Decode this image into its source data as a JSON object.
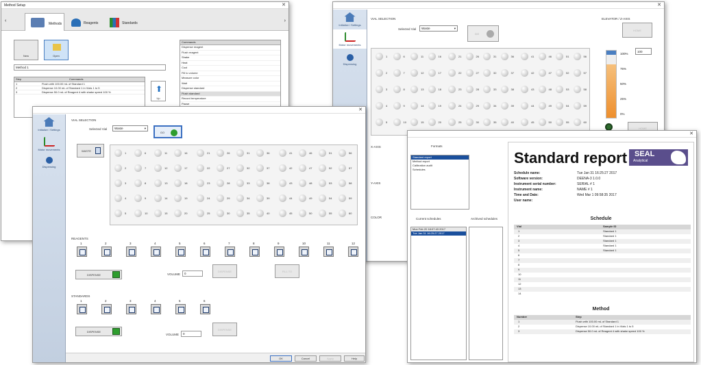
{
  "method_setup": {
    "title": "Method Setup",
    "tabs": [
      "Methods",
      "Reagents",
      "Standards"
    ],
    "new_label": "New",
    "open_label": "Open",
    "method_name": "Method 1",
    "steps_header": [
      "Step",
      "Commands"
    ],
    "steps": [
      [
        "1",
        "Flush with 100.00 mL of Standard 1"
      ],
      [
        "2",
        "Dispense 10.00 mL of Standard 1 in Vials 1 to 5"
      ],
      [
        "3",
        "Dispense 50.0 mL of Reagent 4 with shake speed 100 %"
      ]
    ],
    "up_label": "Up",
    "commands_header": "Commands",
    "commands": [
      "Dispense reagent",
      "Flush reagent",
      "Shake",
      "Heat",
      "Cool",
      "Fill to volume",
      "Measure color",
      "Wait",
      "Dispense standard",
      "Flush standard",
      "Record temperature",
      "Pause"
    ]
  },
  "motor_window": {
    "sidebar": [
      "Initialize / Settings",
      "Motor movements",
      "Dispensing"
    ],
    "vial_selection": "VIAL SELECTION",
    "selected_vial_label": "Selected Vial",
    "selected_vial": "Waste",
    "go_label": "GO",
    "elevator_label": "ELEVATOR / Z-AXIS",
    "home_label": "HOME",
    "levels": [
      "100%",
      "75%",
      "50%",
      "25%",
      "0%"
    ],
    "level_value": "100",
    "xaxis_label": "X-AXIS",
    "yaxis_label": "Y-AXIS",
    "color_label": "COLOR",
    "level_fraction": 0.8
  },
  "vial_window": {
    "sidebar": [
      "Initialize / Settings",
      "Motor movements",
      "Dispensing"
    ],
    "vial_selection": "VIAL SELECTION",
    "selected_vial_label": "Selected Vial",
    "selected_vial": "Waste",
    "go_label": "GO",
    "waste_label": "WASTE",
    "vials": [
      1,
      6,
      11,
      16,
      21,
      26,
      31,
      36,
      41,
      46,
      51,
      56,
      2,
      7,
      12,
      17,
      22,
      27,
      32,
      37,
      42,
      47,
      52,
      57,
      3,
      8,
      13,
      18,
      23,
      28,
      33,
      38,
      43,
      48,
      53,
      58,
      4,
      9,
      14,
      19,
      24,
      29,
      34,
      39,
      44,
      49,
      54,
      59,
      5,
      10,
      15,
      20,
      25,
      30,
      35,
      40,
      45,
      50,
      55,
      60
    ],
    "reagents_label": "REAGENTS",
    "reagents": [
      "1",
      "2",
      "3",
      "4",
      "5",
      "6",
      "7",
      "8",
      "9",
      "10",
      "11",
      "12"
    ],
    "dispense_label": "DISPENSE",
    "volume_label": "VOLUME",
    "volume_value": "0",
    "dispense_grey": "DISPENSE",
    "fill_grey": "FILL TO",
    "standards_label": "STANDARDS",
    "standards": [
      "1",
      "2",
      "3",
      "4",
      "5",
      "6"
    ],
    "ok": "OK",
    "cancel": "Cancel",
    "apply": "Apply",
    "help": "Help"
  },
  "report_window": {
    "formats_label": "Formats",
    "formats": [
      "Standard report",
      "Method report",
      "Calibration audit",
      "Schedules"
    ],
    "current_label": "Current schedules",
    "archived_label": "Archived schedules",
    "current": [
      "Mon Feb 20 18:07:43 2017",
      "Tue Jan 31 16:25:27 2017"
    ],
    "title": "Standard report",
    "logo_top": "SEAL",
    "logo_bottom": "Analytical",
    "info": [
      [
        "Schedule name:",
        "Tue Jan 31 16:25:27 2017"
      ],
      [
        "Software version:",
        "DEENA-3 1.0.0"
      ],
      [
        "Instrument serial number:",
        "SERIAL # 1"
      ],
      [
        "Instrument name:",
        "NAME # 1"
      ],
      [
        "Time and Date:",
        "Wed Mar 1 09:58:35 2017"
      ],
      [
        "User name:",
        ""
      ]
    ],
    "schedule_title": "Schedule",
    "schedule_header": [
      "Vial",
      "Sample ID"
    ],
    "schedule_rows": [
      [
        "1",
        "Standard 1"
      ],
      [
        "2",
        "Standard 1"
      ],
      [
        "3",
        "Standard 1"
      ],
      [
        "4",
        "Standard 1"
      ],
      [
        "5",
        "Standard 1"
      ],
      [
        "6",
        ""
      ],
      [
        "7",
        ""
      ],
      [
        "8",
        ""
      ],
      [
        "9",
        ""
      ],
      [
        "10",
        ""
      ],
      [
        "11",
        ""
      ],
      [
        "12",
        ""
      ],
      [
        "13",
        ""
      ],
      [
        "14",
        ""
      ]
    ],
    "method_title": "Method",
    "method_header": [
      "Number",
      "Step"
    ],
    "method_rows": [
      [
        "1",
        "Flush with 100.00 mL of Standard 1"
      ],
      [
        "2",
        "Dispense 10.00 mL of Standard 1 in Vials 1 to 5"
      ],
      [
        "3",
        "Dispense 50.0 mL of Reagent 4 with shake speed 100 %"
      ]
    ]
  },
  "colors": {
    "accent": "#1a4f9c",
    "go_green": "#2e9d2e",
    "orange": "#f2a24a"
  }
}
